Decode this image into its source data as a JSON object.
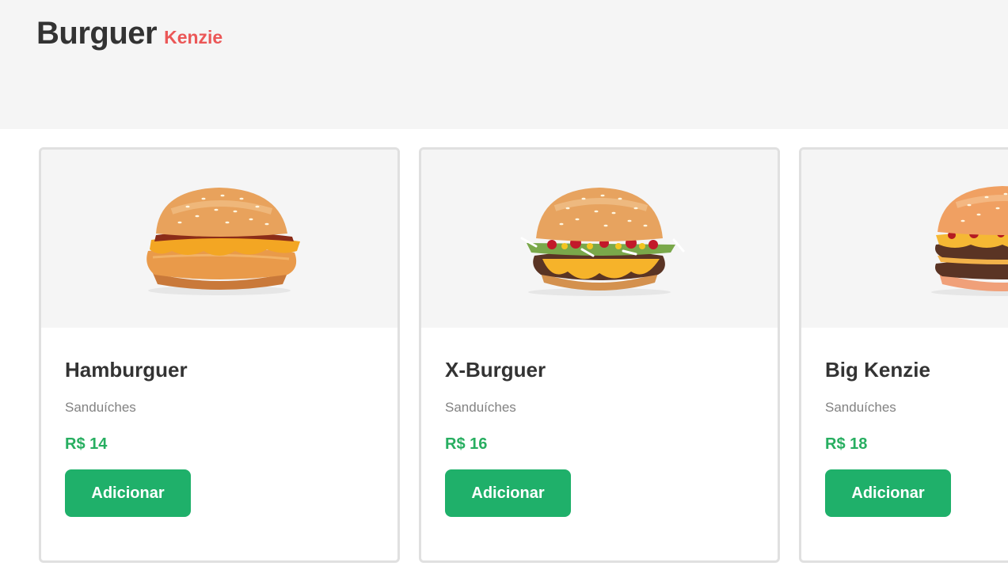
{
  "header": {
    "logo_main": "Burguer",
    "logo_accent": "Kenzie"
  },
  "colors": {
    "header_bg": "#f5f5f5",
    "logo_accent": "#eb5757",
    "price": "#27ae60",
    "button_bg": "#1fb06a",
    "card_border": "#e0e0e0"
  },
  "products": [
    {
      "name": "Hamburguer",
      "category": "Sanduíches",
      "price": "R$ 14",
      "button_label": "Adicionar",
      "image_icon": "chicken-burger-image"
    },
    {
      "name": "X-Burguer",
      "category": "Sanduíches",
      "price": "R$ 16",
      "button_label": "Adicionar",
      "image_icon": "cheeseburger-image"
    },
    {
      "name": "Big Kenzie",
      "category": "Sanduíches",
      "price": "R$ 18",
      "button_label": "Adicionar",
      "image_icon": "double-burger-image"
    }
  ]
}
